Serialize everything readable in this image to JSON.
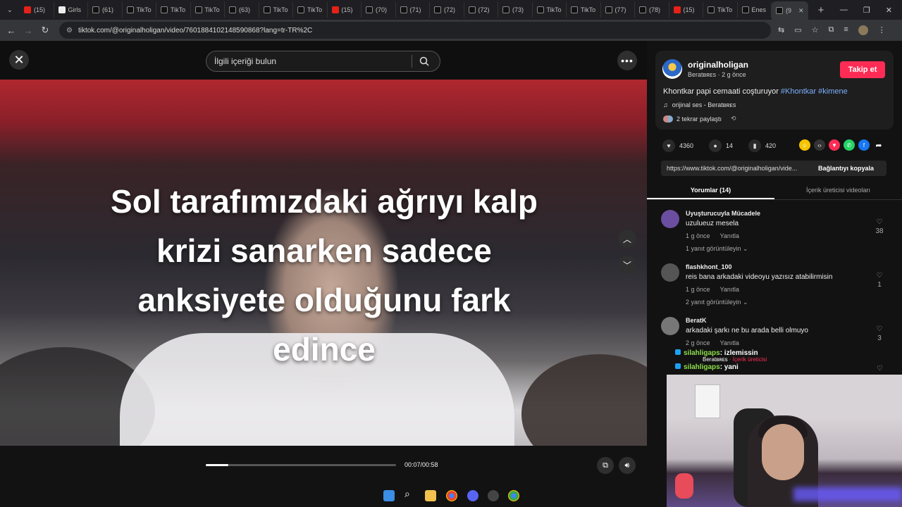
{
  "browser": {
    "tabs": [
      {
        "label": "(15)",
        "icon": "youtube"
      },
      {
        "label": "Girls",
        "icon": "bing"
      },
      {
        "label": "(61)",
        "icon": "tiktok"
      },
      {
        "label": "TikTo",
        "icon": "tiktok"
      },
      {
        "label": "TikTo",
        "icon": "tiktok"
      },
      {
        "label": "TikTo",
        "icon": "tiktok"
      },
      {
        "label": "(63)",
        "icon": "tiktok"
      },
      {
        "label": "TikTo",
        "icon": "tiktok"
      },
      {
        "label": "TikTo",
        "icon": "tiktok"
      },
      {
        "label": "(15)",
        "icon": "youtube"
      },
      {
        "label": "(70)",
        "icon": "tiktok"
      },
      {
        "label": "(71)",
        "icon": "tiktok"
      },
      {
        "label": "(72)",
        "icon": "tiktok"
      },
      {
        "label": "(72)",
        "icon": "tiktok"
      },
      {
        "label": "(73)",
        "icon": "tiktok"
      },
      {
        "label": "TikTo",
        "icon": "tiktok"
      },
      {
        "label": "TikTo",
        "icon": "tiktok"
      },
      {
        "label": "(77)",
        "icon": "tiktok"
      },
      {
        "label": "(78)",
        "icon": "tiktok"
      },
      {
        "label": "(15)",
        "icon": "youtube"
      },
      {
        "label": "TikTo",
        "icon": "tiktok"
      },
      {
        "label": "Enes",
        "icon": "tiktok"
      },
      {
        "label": "(9",
        "icon": "tiktok",
        "active": true
      }
    ],
    "url": "tiktok.com/@originalholigan/video/7601884102148590868?lang=tr-TR%2C"
  },
  "video": {
    "search_placeholder": "İlgili içeriği bulun",
    "caption_lines": [
      "Sol tarafımızdaki ağrıyı kalp",
      "krizi sanarken sadece",
      "anksiyete olduğunu fark",
      "edince"
    ],
    "time": "00:07/00:58",
    "progress": 0.12
  },
  "author": {
    "name": "originalholigan",
    "sub": "Beratʙʀᴇs · 2 g önce",
    "follow_label": "Takip et",
    "desc_text": "Khontkar papi cemaati coşturuyor ",
    "hashtags": "#Khontkar #kimene",
    "music": "orijinal ses - Beratʙʀᴇs",
    "reposts": "2 tekrar paylaştı"
  },
  "stats": {
    "likes": "4360",
    "comments": "14",
    "saves": "420"
  },
  "link": {
    "url": "https://www.tiktok.com/@originalholigan/vide...",
    "copy_label": "Bağlantıyı kopyala"
  },
  "tabs": {
    "comments": "Yorumlar (14)",
    "creator_videos": "İçerik üreticisi videoları"
  },
  "comments": [
    {
      "user": "Uyuşturucuyla Mücadele",
      "text": "uzulueuz mesela",
      "time": "1 g önce",
      "reply": "Yanıtla",
      "more": "1 yanıt görüntüleyin ⌄",
      "likes": "38",
      "color": "#6b4ea0"
    },
    {
      "user": "flashkhont_100",
      "text": "reis bana arkadaki videoyu yazısız atabilirmisin",
      "time": "1 g önce",
      "reply": "Yanıtla",
      "more": "2 yanıt görüntüleyin ⌄",
      "likes": "1",
      "color": "#555"
    },
    {
      "user": "BeratK",
      "text": "arkadaki şarkı ne bu arada belli olmuyo",
      "time": "2 g önce",
      "reply": "Yanıtla",
      "more": "",
      "likes": "3",
      "color": "#777"
    }
  ],
  "chat": [
    {
      "user": "silahligaps",
      "msg": ": izlemissin"
    },
    {
      "user": "silahligaps",
      "msg": ": yani"
    }
  ],
  "overlay": {
    "name": "Beratʙʀᴇs",
    "tag": "· İçerik üreticisi"
  }
}
